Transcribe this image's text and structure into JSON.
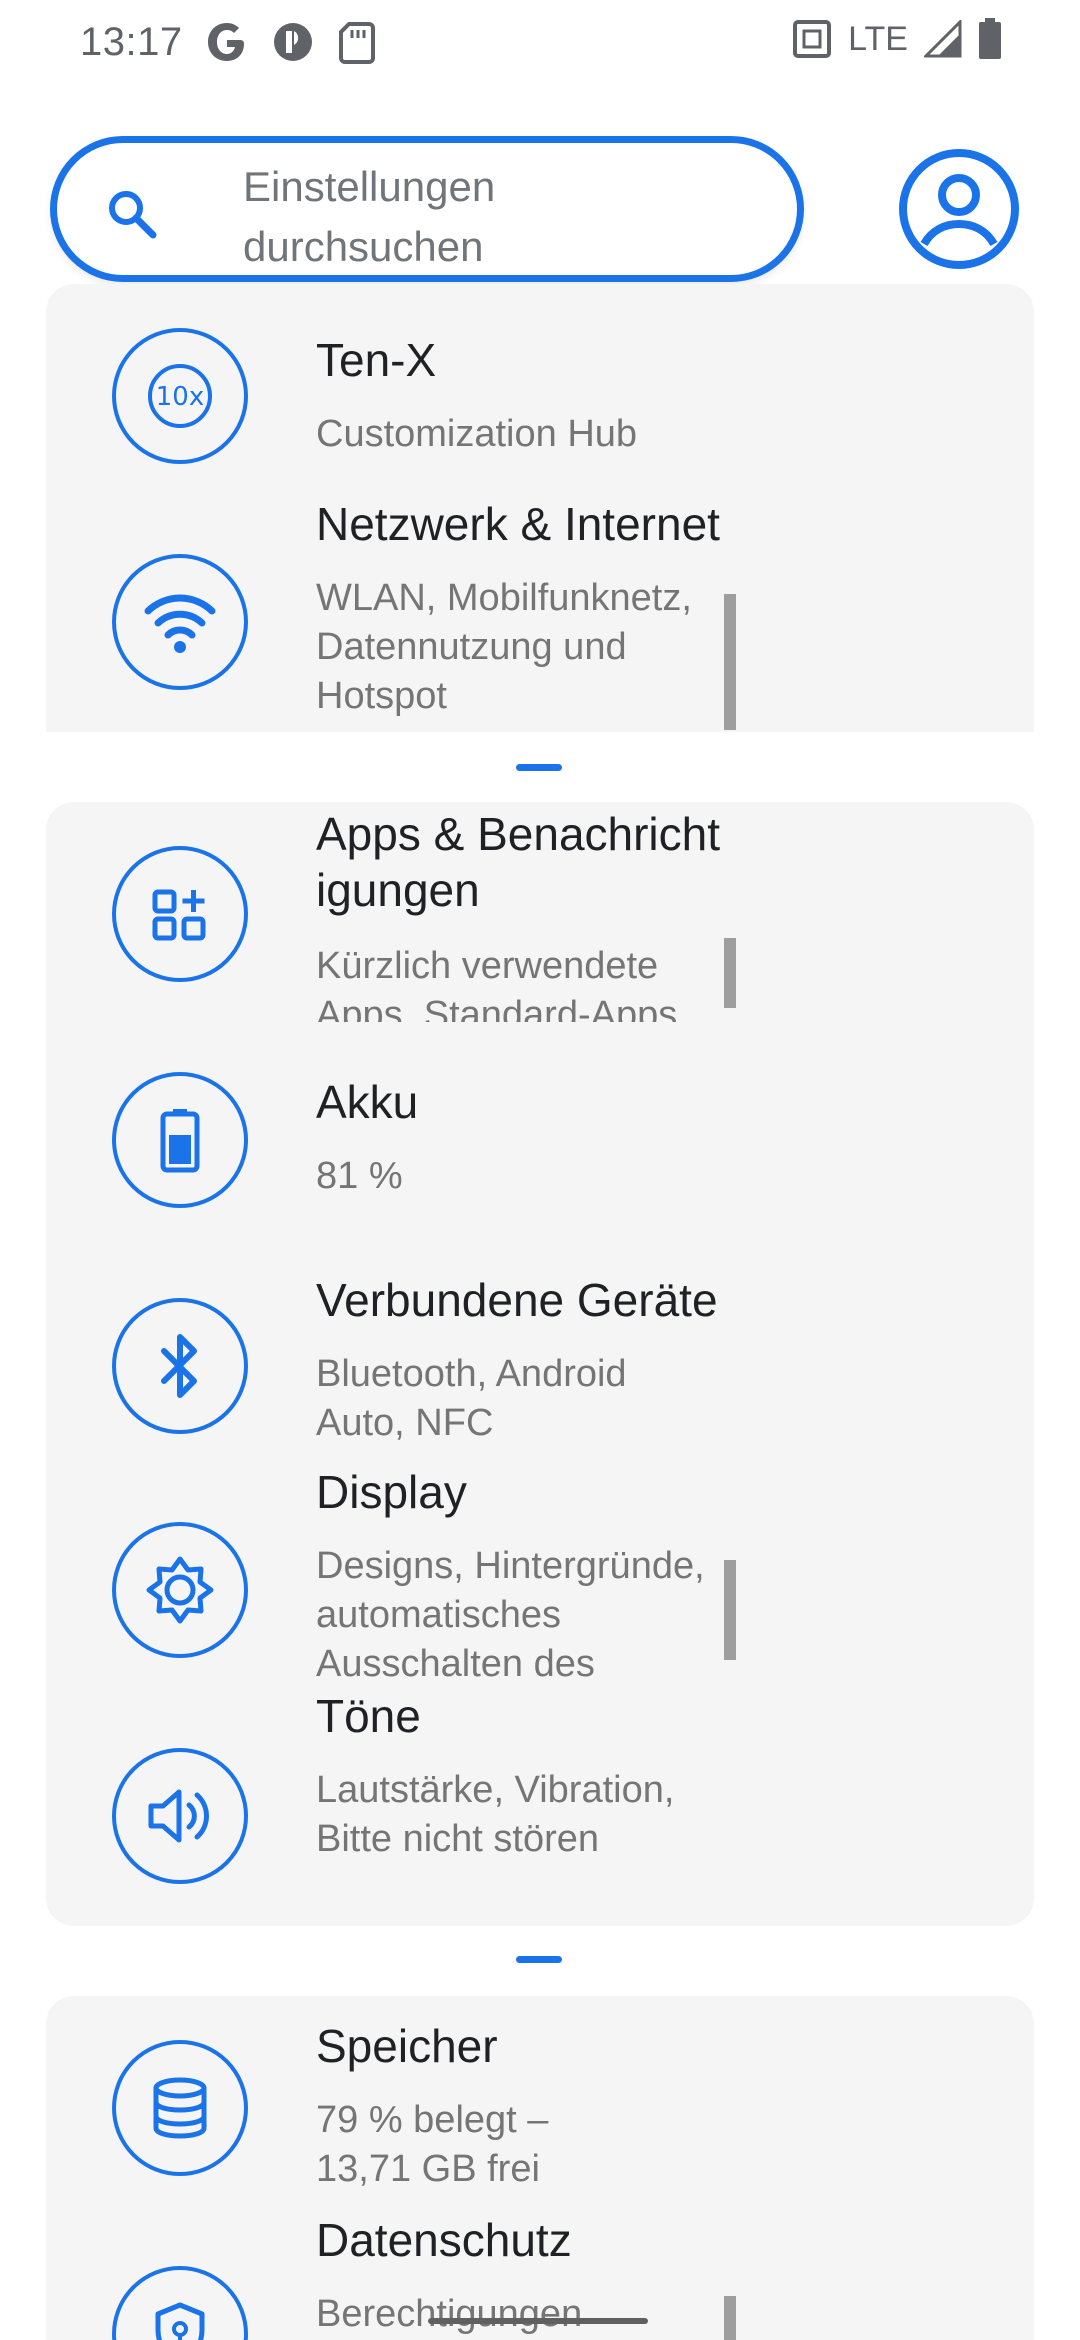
{
  "status_bar": {
    "time": "13:17",
    "left_icons": [
      "google-icon",
      "notification-icon",
      "sd-card-icon"
    ],
    "network": "LTE",
    "right_icons": [
      "nfc-icon",
      "signal-icon",
      "battery-icon"
    ]
  },
  "search": {
    "placeholder_line1": "Einstellungen",
    "placeholder_line2": "durchsuchen"
  },
  "colors": {
    "accent": "#1a73e8",
    "card_bg": "#f5f5f5",
    "title": "#202124",
    "subtitle": "#757575"
  },
  "settings": [
    {
      "title": "Ten-X",
      "subtitle": "Customization Hub",
      "icon": "tenx-icon"
    },
    {
      "title": "Netzwerk & Internet",
      "subtitle": "WLAN, Mobilfunknetz, Datennutzung und Hotspot",
      "icon": "wifi-icon"
    },
    {
      "title": "Apps & Benachrichtigungen",
      "title_line1": "Apps & Benachricht",
      "title_line2": "igungen",
      "subtitle": "Kürzlich verwendete Apps, Standard-Apps",
      "icon": "apps-icon"
    },
    {
      "title": "Akku",
      "subtitle": "81 %",
      "icon": "battery-icon"
    },
    {
      "title": "Verbundene Geräte",
      "subtitle": "Bluetooth, Android Auto, NFC",
      "icon": "bluetooth-icon"
    },
    {
      "title": "Display",
      "subtitle": "Designs, Hintergründe, automatisches Ausschalten des",
      "icon": "brightness-icon"
    },
    {
      "title": "Töne",
      "subtitle": "Lautstärke, Vibration, Bitte nicht stören",
      "icon": "volume-icon"
    },
    {
      "title": "Speicher",
      "subtitle": "79 % belegt – 13,71 GB frei",
      "icon": "storage-icon"
    },
    {
      "title": "Datenschutz",
      "subtitle": "Berechtigungen",
      "icon": "privacy-icon"
    }
  ]
}
